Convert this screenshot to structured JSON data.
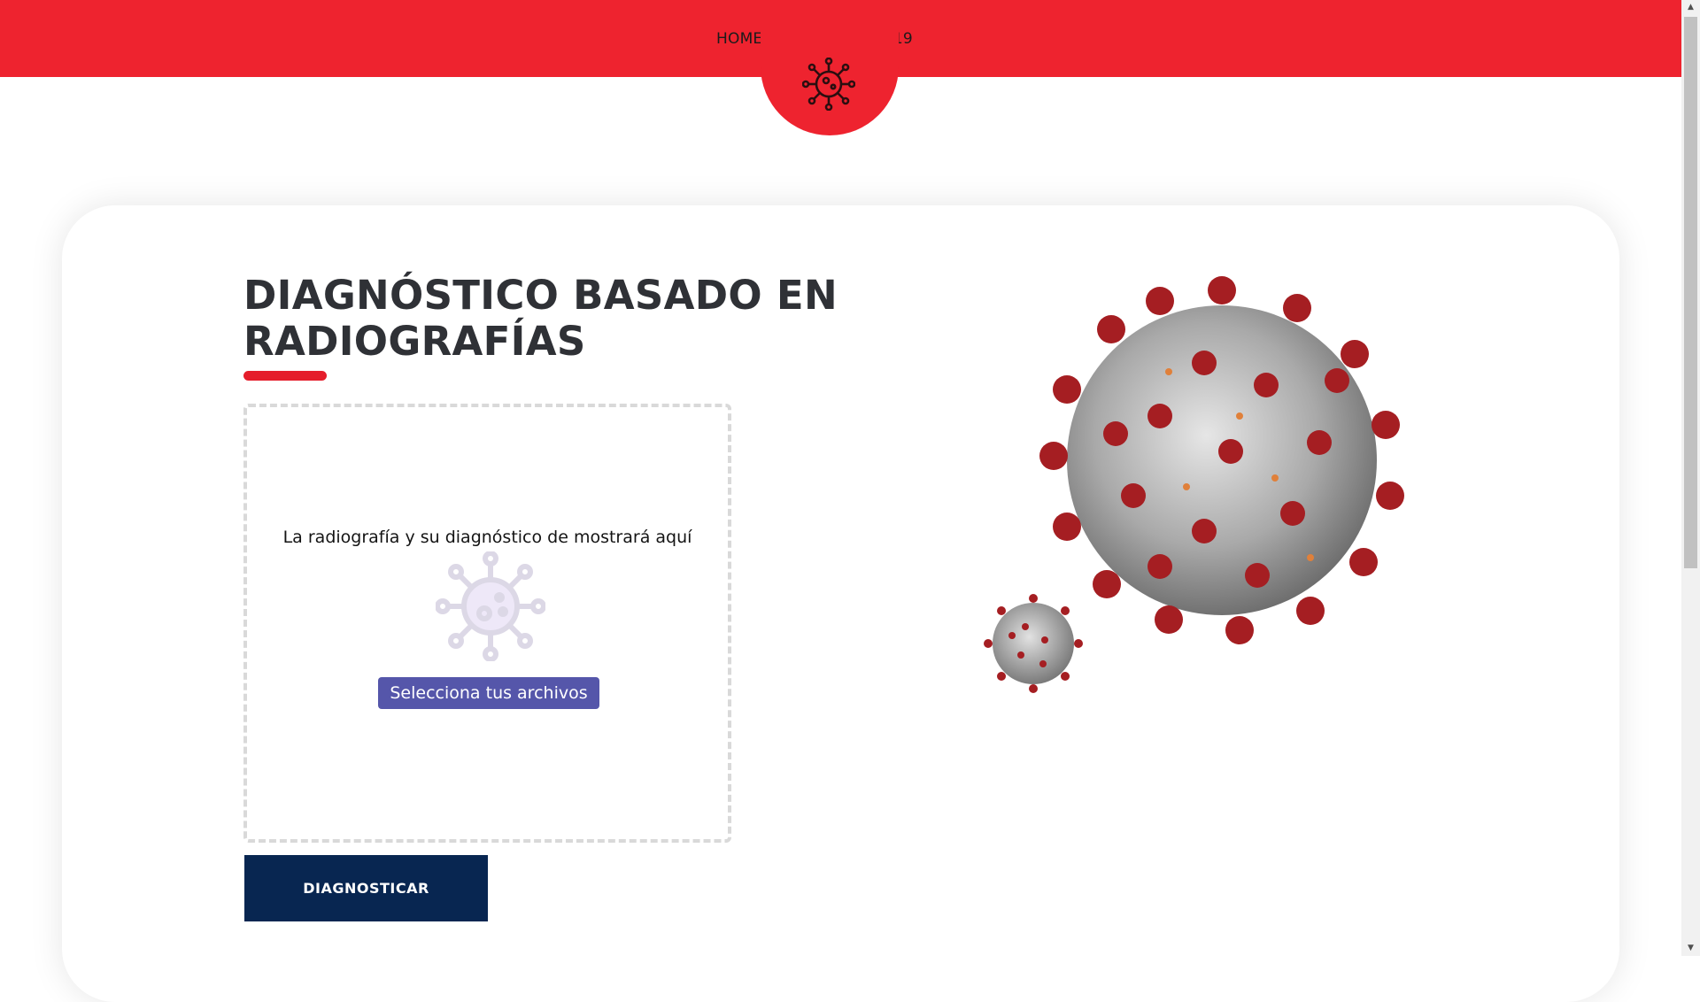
{
  "nav": {
    "home_label": "HOME",
    "brand_label": "DIAGNOS19"
  },
  "main": {
    "title": "DIAGNÓSTICO BASADO EN RADIOGRAFÍAS",
    "dropzone_text": "La radiografía y su diagnóstico de mostrará aquí",
    "select_button_label": "Selecciona tus archivos",
    "diagnose_button_label": "DIAGNOSTICAR"
  },
  "icons": {
    "logo": "virus-icon",
    "dropzone": "virus-icon",
    "scroll_up": "arrow-up-icon",
    "scroll_down": "arrow-down-icon"
  },
  "colors": {
    "header": "#ee232f",
    "accent_underline": "#e51d2b",
    "select_button": "#5556aa",
    "diagnose_button": "#082651",
    "title": "#2f3136"
  }
}
